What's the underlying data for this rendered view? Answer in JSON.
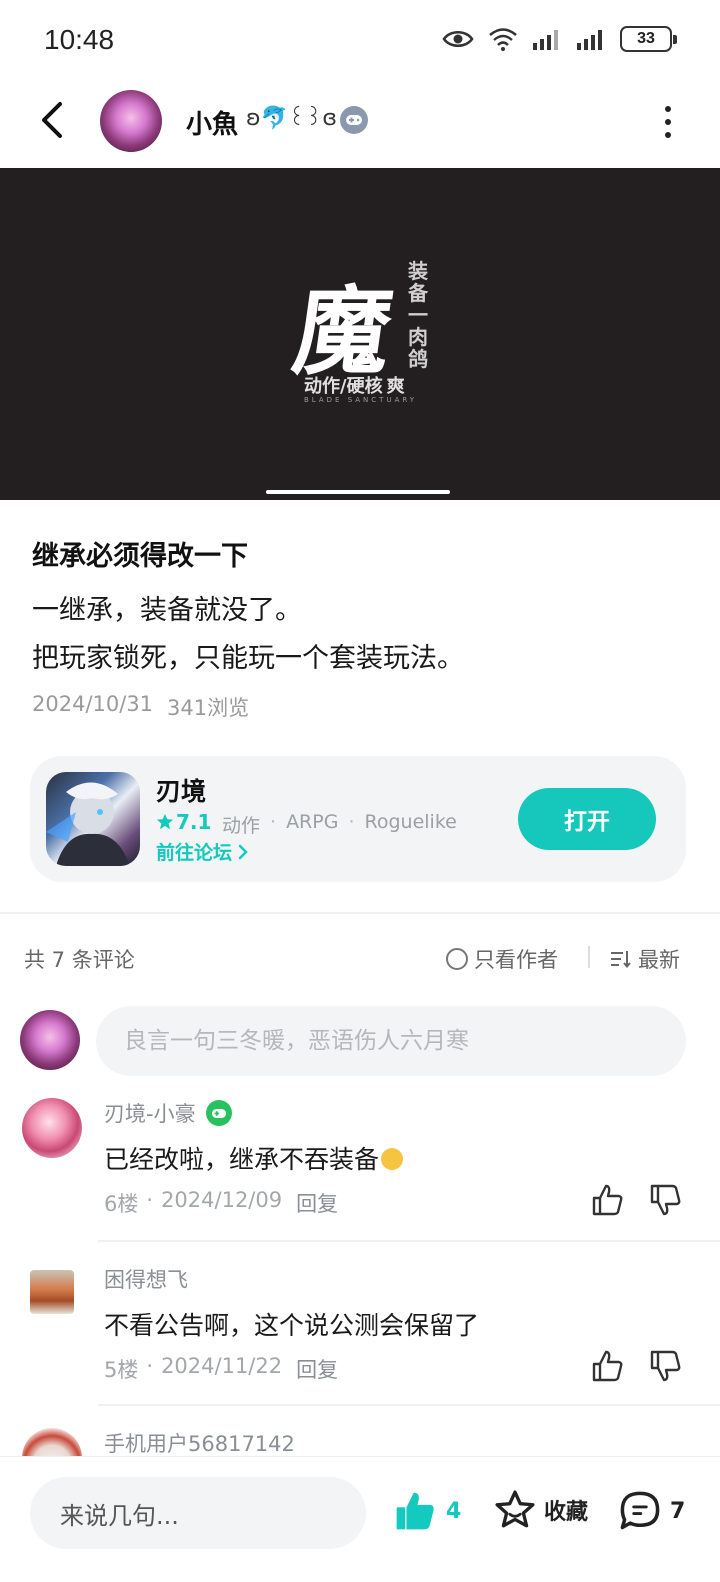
{
  "status_bar": {
    "time": "10:48",
    "battery": "33",
    "icons": [
      "eye-icon",
      "wifi-icon",
      "signal-icon",
      "signal-icon"
    ]
  },
  "header": {
    "username": "小魚",
    "username_decor": "ʚ🐬꒰꒱ɞ",
    "badge_icon": "gamepad-icon",
    "back_icon": "chevron-left-icon",
    "more_icon": "more-vertical-icon"
  },
  "banner": {
    "logo_main": "魔",
    "logo_side": "装备一肉鸽",
    "logo_sub": "动作/硬核",
    "logo_tag": "爽",
    "logo_small": "BLADE SANCTUARY"
  },
  "post": {
    "title": "继承必须得改一下",
    "lines": [
      "一继承，装备就没了。",
      "把玩家锁死，只能玩一个套装玩法。"
    ],
    "date": "2024/10/31",
    "views": "341浏览"
  },
  "game": {
    "name": "刃境",
    "rating": "7.1",
    "tags": [
      "动作",
      "ARPG",
      "Roguelike"
    ],
    "forum_link": "前往论坛",
    "open_button": "打开"
  },
  "comments_header": {
    "count_text": "共 7 条评论",
    "author_only": "只看作者",
    "sort": "最新"
  },
  "comment_input": {
    "placeholder": "良言一句三冬暖，恶语伤人六月寒"
  },
  "comments": [
    {
      "user": "刃境-小豪",
      "text": "已经改啦，继承不吞装备",
      "floor": "6楼",
      "date": "2024/12/09",
      "reply": "回复"
    },
    {
      "user": "困得想飞",
      "text": "不看公告啊，这个说公测会保留了",
      "floor": "5楼",
      "date": "2024/11/22",
      "reply": "回复"
    },
    {
      "user": "手机用户56817142"
    }
  ],
  "bottom_bar": {
    "say_placeholder": "来说几句...",
    "likes": "4",
    "collect": "收藏",
    "comments": "7"
  },
  "colors": {
    "accent": "#15c8bb",
    "banner_bg": "#231f20",
    "card_bg": "#f2f4f5"
  }
}
